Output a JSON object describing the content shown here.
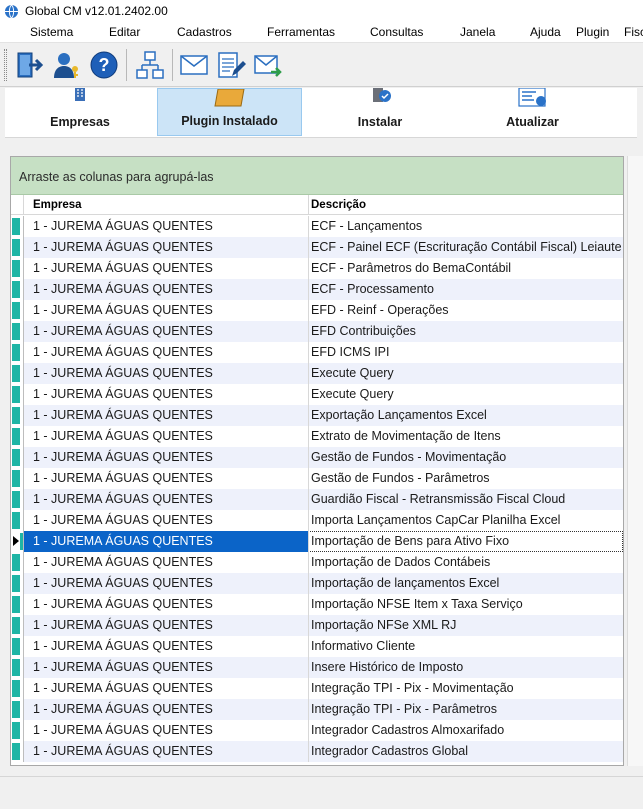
{
  "window": {
    "title": "Global CM v12.01.2402.00"
  },
  "menu": [
    "Sistema",
    "Editar",
    "Cadastros",
    "Ferramentas",
    "Consultas",
    "Janela",
    "Ajuda",
    "Plugin",
    "Fisc"
  ],
  "toolbar": {
    "icons": [
      "exit-icon",
      "user-key-icon",
      "help-icon",
      "network-icon",
      "mail-icon",
      "edit-sheet-icon",
      "send-mail-icon"
    ]
  },
  "ribbon": {
    "buttons": [
      {
        "label": "Empresas",
        "icon": "building-icon"
      },
      {
        "label": "Plugin Instalado",
        "icon": "folder-icon"
      },
      {
        "label": "Instalar",
        "icon": "install-icon"
      },
      {
        "label": "Atualizar",
        "icon": "update-icon"
      }
    ]
  },
  "grid": {
    "group_hint": "Arraste as colunas para agrupá-las",
    "columns": [
      "Empresa",
      "Descrição"
    ],
    "rows": [
      [
        "1 - JUREMA ÁGUAS QUENTES",
        "ECF - Lançamentos"
      ],
      [
        "1 - JUREMA ÁGUAS QUENTES",
        "ECF - Painel ECF (Escrituração Contábil Fiscal) Leiaute"
      ],
      [
        "1 - JUREMA ÁGUAS QUENTES",
        "ECF - Parâmetros do BemaContábil"
      ],
      [
        "1 - JUREMA ÁGUAS QUENTES",
        "ECF - Processamento"
      ],
      [
        "1 - JUREMA ÁGUAS QUENTES",
        "EFD - Reinf - Operações"
      ],
      [
        "1 - JUREMA ÁGUAS QUENTES",
        "EFD Contribuições"
      ],
      [
        "1 - JUREMA ÁGUAS QUENTES",
        "EFD ICMS IPI"
      ],
      [
        "1 - JUREMA ÁGUAS QUENTES",
        "Execute Query"
      ],
      [
        "1 - JUREMA ÁGUAS QUENTES",
        "Execute Query"
      ],
      [
        "1 - JUREMA ÁGUAS QUENTES",
        "Exportação Lançamentos Excel"
      ],
      [
        "1 - JUREMA ÁGUAS QUENTES",
        "Extrato de Movimentação de Itens"
      ],
      [
        "1 - JUREMA ÁGUAS QUENTES",
        "Gestão de Fundos - Movimentação"
      ],
      [
        "1 - JUREMA ÁGUAS QUENTES",
        "Gestão de Fundos - Parâmetros"
      ],
      [
        "1 - JUREMA ÁGUAS QUENTES",
        "Guardião Fiscal - Retransmissão Fiscal Cloud"
      ],
      [
        "1 - JUREMA ÁGUAS QUENTES",
        "Importa Lançamentos CapCar Planilha Excel"
      ],
      [
        "1 - JUREMA ÁGUAS QUENTES",
        "Importação de Bens para Ativo Fixo"
      ],
      [
        "1 - JUREMA ÁGUAS QUENTES",
        "Importação de Dados Contábeis"
      ],
      [
        "1 - JUREMA ÁGUAS QUENTES",
        "Importação de lançamentos Excel"
      ],
      [
        "1 - JUREMA ÁGUAS QUENTES",
        "Importação NFSE Item x Taxa Serviço"
      ],
      [
        "1 - JUREMA ÁGUAS QUENTES",
        "Importação NFSe XML RJ"
      ],
      [
        "1 - JUREMA ÁGUAS QUENTES",
        "Informativo Cliente"
      ],
      [
        "1 - JUREMA ÁGUAS QUENTES",
        "Insere Histórico de Imposto"
      ],
      [
        "1 - JUREMA ÁGUAS QUENTES",
        "Integração TPI - Pix - Movimentação"
      ],
      [
        "1 - JUREMA ÁGUAS QUENTES",
        "Integração TPI - Pix - Parâmetros"
      ],
      [
        "1 - JUREMA ÁGUAS QUENTES",
        "Integrador Cadastros Almoxarifado"
      ],
      [
        "1 - JUREMA ÁGUAS QUENTES",
        "Integrador Cadastros Global"
      ]
    ],
    "selected_row": 15
  },
  "colors": {
    "selection": "#0b64c8",
    "group_panel": "#c6e0c4",
    "row_marker": "#1fb5a5",
    "active_ribbon": "#cce4f7"
  }
}
